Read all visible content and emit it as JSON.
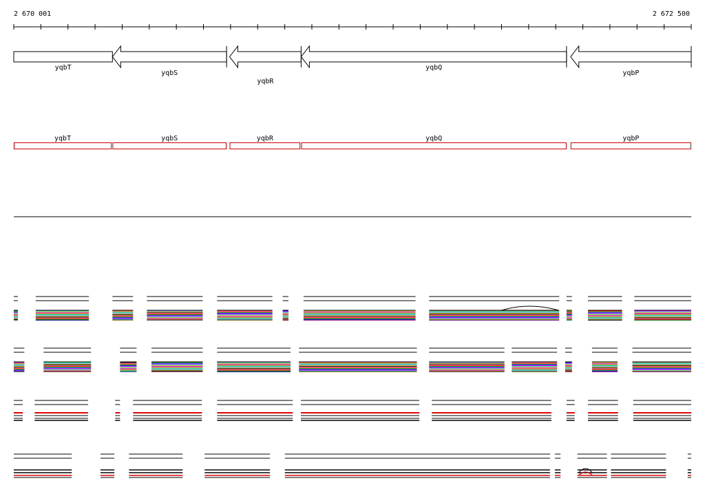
{
  "ruler": {
    "start_label": "2 670 001",
    "end_label": "2 672 500",
    "start": 2670001,
    "end": 2672500
  },
  "colors": {
    "gene_outline": "#000000",
    "cds_outline": "#cc0000",
    "axis": "#000000",
    "highlight": "#e00000"
  },
  "genes": [
    {
      "name": "yqbT",
      "start": 2670001,
      "end": 2670365,
      "strand": "+",
      "label_row": 0
    },
    {
      "name": "yqbS",
      "start": 2670365,
      "end": 2670786,
      "strand": "-",
      "label_row": 1
    },
    {
      "name": "yqbR",
      "start": 2670797,
      "end": 2671061,
      "strand": "-",
      "label_row": 2
    },
    {
      "name": "yqbQ",
      "start": 2671061,
      "end": 2672040,
      "strand": "-",
      "label_row": 0
    },
    {
      "name": "yqbP",
      "start": 2672055,
      "end": 2672500,
      "strand": "-",
      "label_row": 1
    }
  ],
  "cds": [
    {
      "name": "yqbT",
      "start": 2670001,
      "end": 2670362
    },
    {
      "name": "yqbS",
      "start": 2670365,
      "end": 2670786
    },
    {
      "name": "yqbR",
      "start": 2670797,
      "end": 2671058
    },
    {
      "name": "yqbQ",
      "start": 2671061,
      "end": 2672040
    },
    {
      "name": "yqbP",
      "start": 2672055,
      "end": 2672500
    }
  ],
  "tracks": [
    {
      "name": "track-1",
      "style": "colorful",
      "blocks": [
        [
          2670001,
          2670016
        ],
        [
          2670082,
          2670278
        ],
        [
          2670365,
          2670441
        ],
        [
          2670492,
          2670698
        ],
        [
          2670751,
          2670955
        ],
        [
          2670993,
          2671014
        ],
        [
          2671070,
          2671483
        ],
        [
          2671533,
          2672013
        ],
        [
          2672040,
          2672060
        ],
        [
          2672119,
          2672245
        ],
        [
          2672290,
          2672500
        ]
      ],
      "bump": [
        2671800,
        2672010
      ]
    },
    {
      "name": "track-2",
      "style": "colorful",
      "blocks": [
        [
          2670001,
          2670040
        ],
        [
          2670111,
          2670286
        ],
        [
          2670393,
          2670454
        ],
        [
          2670509,
          2670698
        ],
        [
          2670751,
          2671022
        ],
        [
          2671053,
          2671488
        ],
        [
          2671533,
          2671811
        ],
        [
          2671838,
          2672005
        ],
        [
          2672035,
          2672060
        ],
        [
          2672134,
          2672228
        ],
        [
          2672283,
          2672500
        ]
      ],
      "bump": null
    },
    {
      "name": "track-3",
      "style": "redline",
      "blocks": [
        [
          2670001,
          2670034
        ],
        [
          2670078,
          2670275
        ],
        [
          2670375,
          2670393
        ],
        [
          2670441,
          2670695
        ],
        [
          2670751,
          2671030
        ],
        [
          2671060,
          2671497
        ],
        [
          2671543,
          2671984
        ],
        [
          2672040,
          2672070
        ],
        [
          2672119,
          2672230
        ],
        [
          2672286,
          2672500
        ]
      ]
    },
    {
      "name": "track-4",
      "style": "redline-dense",
      "blocks": [
        [
          2670001,
          2670215
        ],
        [
          2670321,
          2670372
        ],
        [
          2670426,
          2670624
        ],
        [
          2670705,
          2670946
        ],
        [
          2671001,
          2671979
        ],
        [
          2671997,
          2672018
        ],
        [
          2672080,
          2672189
        ],
        [
          2672204,
          2672407
        ],
        [
          2672487,
          2672500
        ]
      ],
      "bump": [
        2672085,
        2672135
      ]
    }
  ]
}
